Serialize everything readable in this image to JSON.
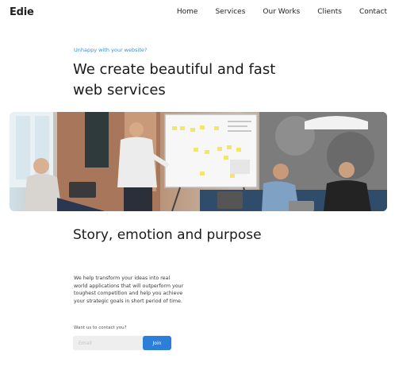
{
  "brand": {
    "logo": "Edie"
  },
  "nav": [
    {
      "label": "Home"
    },
    {
      "label": "Services"
    },
    {
      "label": "Our Works"
    },
    {
      "label": "Clients"
    },
    {
      "label": "Contact"
    }
  ],
  "hero": {
    "eyebrow": "Unhappy with your website?",
    "title": "We create beautiful and fast web services",
    "image_alt": "Team meeting in an office with a whiteboard"
  },
  "story": {
    "title": "Story, emotion and purpose",
    "body": "We help transform your ideas into real world applications that will outperform your toughest competition and help you achieve your strategic goals in short period of time."
  },
  "contact": {
    "label": "Want us to contact you?",
    "email_placeholder": "Email",
    "button_label": "Join"
  },
  "colors": {
    "accent": "#2b7fd8",
    "eyebrow": "#3a8fd6",
    "text": "#1a1a1a"
  }
}
